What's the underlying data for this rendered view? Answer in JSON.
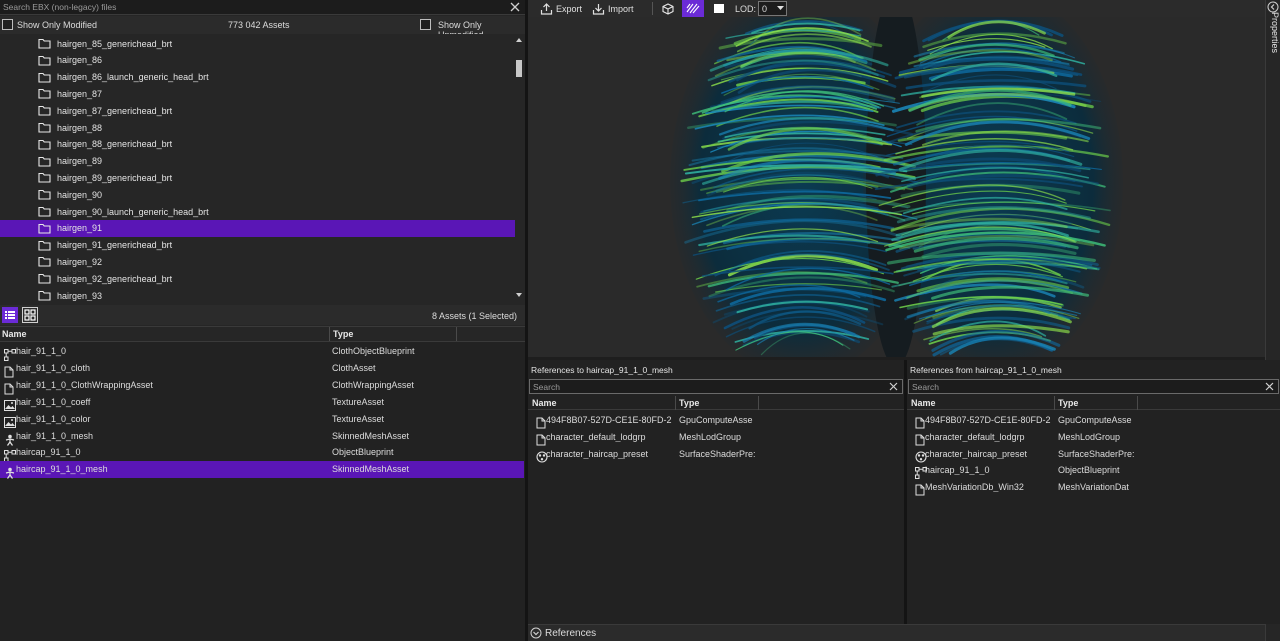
{
  "search": {
    "placeholder": "Search EBX (non-legacy) files"
  },
  "filters": {
    "show_modified": "Show Only Modified",
    "asset_count": "773 042 Assets",
    "show_unmodified": "Show Only Unmodified"
  },
  "tree": {
    "items": [
      {
        "label": "hairgen_85_generichead_brt"
      },
      {
        "label": "hairgen_86"
      },
      {
        "label": "hairgen_86_launch_generic_head_brt"
      },
      {
        "label": "hairgen_87"
      },
      {
        "label": "hairgen_87_generichead_brt"
      },
      {
        "label": "hairgen_88"
      },
      {
        "label": "hairgen_88_generichead_brt"
      },
      {
        "label": "hairgen_89"
      },
      {
        "label": "hairgen_89_generichead_brt"
      },
      {
        "label": "hairgen_90"
      },
      {
        "label": "hairgen_90_launch_generic_head_brt"
      },
      {
        "label": "hairgen_91"
      },
      {
        "label": "hairgen_91_generichead_brt"
      },
      {
        "label": "hairgen_92"
      },
      {
        "label": "hairgen_92_generichead_brt"
      },
      {
        "label": "hairgen_93"
      }
    ],
    "selected_index": 11
  },
  "asset_list": {
    "summary": "8 Assets (1 Selected)",
    "col_name": "Name",
    "col_type": "Type",
    "rows": [
      {
        "name": "hair_91_1_0",
        "type": "ClothObjectBlueprint",
        "icon": "blueprint-icon"
      },
      {
        "name": "hair_91_1_0_cloth",
        "type": "ClothAsset",
        "icon": "file-icon"
      },
      {
        "name": "hair_91_1_0_ClothWrappingAsset",
        "type": "ClothWrappingAsset",
        "icon": "file-icon"
      },
      {
        "name": "hair_91_1_0_coeff",
        "type": "TextureAsset",
        "icon": "image-icon"
      },
      {
        "name": "hair_91_1_0_color",
        "type": "TextureAsset",
        "icon": "image-icon"
      },
      {
        "name": "hair_91_1_0_mesh",
        "type": "SkinnedMeshAsset",
        "icon": "person-icon"
      },
      {
        "name": "haircap_91_1_0",
        "type": "ObjectBlueprint",
        "icon": "blueprint-icon"
      },
      {
        "name": "haircap_91_1_0_mesh",
        "type": "SkinnedMeshAsset",
        "icon": "person-icon"
      }
    ],
    "selected_index": 7
  },
  "toolbar": {
    "export": "Export",
    "import": "Import",
    "lod_label": "LOD:",
    "lod_value": "0"
  },
  "properties_tab": "Properties",
  "refs_to": {
    "title": "References to haircap_91_1_0_mesh",
    "search_placeholder": "Search",
    "col_name": "Name",
    "col_type": "Type",
    "rows": [
      {
        "name": "494F8B07-527D-CE1E-80FD-2",
        "type": "GpuComputeAsse",
        "icon": "file-icon"
      },
      {
        "name": "character_default_lodgrp",
        "type": "MeshLodGroup",
        "icon": "file-icon"
      },
      {
        "name": "character_haircap_preset",
        "type": "SurfaceShaderPre:",
        "icon": "shader-icon"
      }
    ]
  },
  "refs_from": {
    "title": "References from haircap_91_1_0_mesh",
    "search_placeholder": "Search",
    "col_name": "Name",
    "col_type": "Type",
    "rows": [
      {
        "name": "494F8B07-527D-CE1E-80FD-2",
        "type": "GpuComputeAsse",
        "icon": "file-icon"
      },
      {
        "name": "character_default_lodgrp",
        "type": "MeshLodGroup",
        "icon": "file-icon"
      },
      {
        "name": "character_haircap_preset",
        "type": "SurfaceShaderPre:",
        "icon": "shader-icon"
      },
      {
        "name": "haircap_91_1_0",
        "type": "ObjectBlueprint",
        "icon": "blueprint-icon"
      },
      {
        "name": "MeshVariationDb_Win32",
        "type": "MeshVariationDat",
        "icon": "file-icon"
      }
    ]
  },
  "footer": {
    "label": "References"
  },
  "colors": {
    "selection": "#5a16b6",
    "accent": "#6b2bd6"
  }
}
